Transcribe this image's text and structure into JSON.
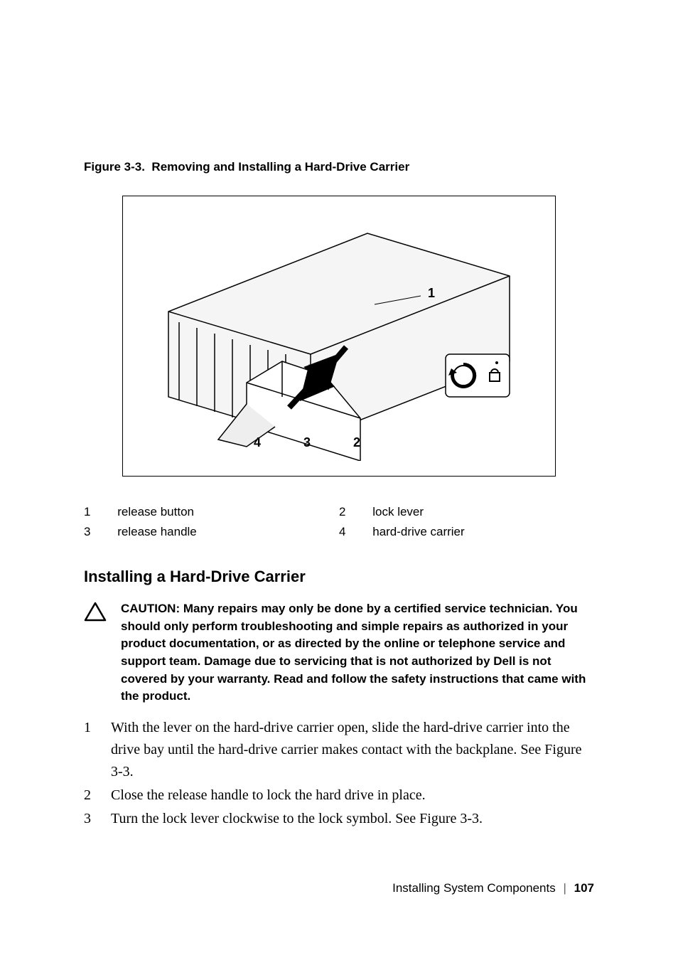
{
  "figure": {
    "caption_prefix": "Figure 3-3.",
    "caption_title": "Removing and Installing a Hard-Drive Carrier",
    "callouts": [
      "1",
      "2",
      "3",
      "4"
    ],
    "alt": "Technical illustration of a server chassis with hard-drive bays. A hard-drive carrier is shown partially removed with numbered callouts: 1 on the chassis frame, 2 for the lock lever (with rotation arrow inset), 3 for the release handle, 4 for the hard-drive carrier."
  },
  "legend": [
    {
      "num": "1",
      "label": "release button"
    },
    {
      "num": "2",
      "label": "lock lever"
    },
    {
      "num": "3",
      "label": "release handle"
    },
    {
      "num": "4",
      "label": "hard-drive carrier"
    }
  ],
  "section_heading": "Installing a Hard-Drive Carrier",
  "caution": {
    "text": "CAUTION: Many repairs may only be done by a certified service technician. You should only perform troubleshooting and simple repairs as authorized in your product documentation, or as directed by the online or telephone service and support team. Damage due to servicing that is not authorized by Dell is not covered by your warranty. Read and follow the safety instructions that came with the product."
  },
  "steps": [
    {
      "num": "1",
      "text": "With the lever on the hard-drive carrier open, slide the hard-drive carrier into the drive bay until the hard-drive carrier makes contact with the backplane. See Figure 3-3."
    },
    {
      "num": "2",
      "text": "Close the release handle to lock the hard drive in place."
    },
    {
      "num": "3",
      "text": "Turn the lock lever clockwise to the lock symbol. See Figure 3-3."
    }
  ],
  "footer": {
    "section": "Installing System Components",
    "page": "107"
  }
}
